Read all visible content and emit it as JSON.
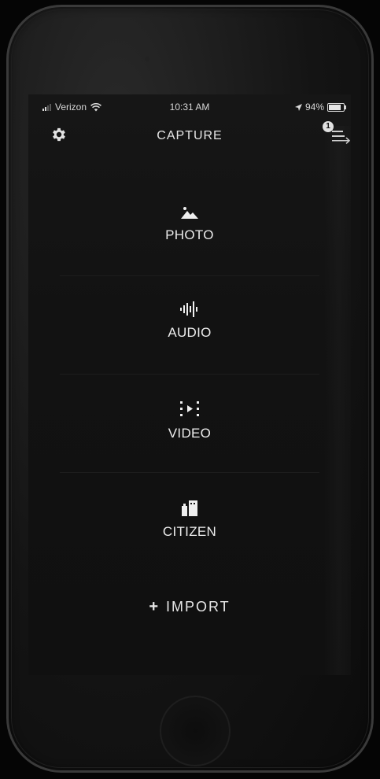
{
  "status_bar": {
    "carrier": "Verizon",
    "time": "10:31 AM",
    "battery_text": "94%",
    "battery_level": 0.94
  },
  "nav": {
    "title": "CAPTURE",
    "settings_icon": "gear-icon",
    "queue_count": "1",
    "queue_icon": "upload-queue-icon"
  },
  "capture_options": [
    {
      "label": "PHOTO",
      "icon": "mountain-photo-icon"
    },
    {
      "label": "AUDIO",
      "icon": "audio-waveform-icon"
    },
    {
      "label": "VIDEO",
      "icon": "video-frame-icon"
    },
    {
      "label": "CITIZEN",
      "icon": "city-buildings-icon"
    }
  ],
  "import": {
    "label": "IMPORT",
    "icon": "plus-icon"
  },
  "colors": {
    "screen_bg": "#141414",
    "text": "#e9e9e9",
    "frame": "#1a1a1a"
  }
}
